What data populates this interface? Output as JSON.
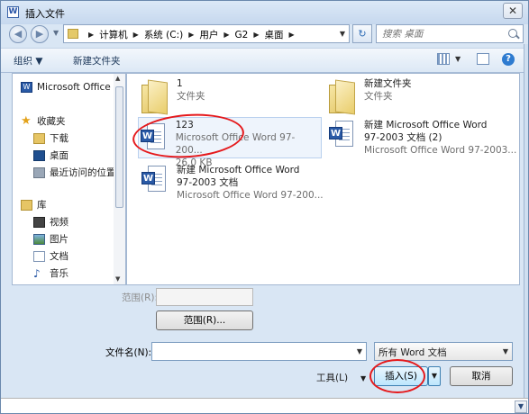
{
  "window": {
    "title": "插入文件",
    "title_icon": "W",
    "close_label": "✕"
  },
  "address": {
    "crumbs": [
      "计算机",
      "系统 (C:)",
      "用户",
      "G2",
      "桌面"
    ]
  },
  "search": {
    "placeholder": "搜索 桌面"
  },
  "toolbar": {
    "organize": "组织 ▼",
    "new_folder": "新建文件夹"
  },
  "nav": {
    "items": [
      {
        "label": "Microsoft Office W",
        "icon": "word-icon"
      },
      {
        "label": "收藏夹",
        "icon": "star-icon"
      },
      {
        "label": "下载",
        "icon": "download-folder-icon"
      },
      {
        "label": "桌面",
        "icon": "desktop-icon"
      },
      {
        "label": "最近访问的位置",
        "icon": "recent-places-icon"
      },
      {
        "label": "库",
        "icon": "library-icon"
      },
      {
        "label": "视频",
        "icon": "video-icon"
      },
      {
        "label": "图片",
        "icon": "picture-icon"
      },
      {
        "label": "文档",
        "icon": "document-icon"
      },
      {
        "label": "音乐",
        "icon": "music-icon"
      }
    ]
  },
  "files": [
    {
      "name": "1",
      "type": "文件夹",
      "size": "",
      "kind": "folder"
    },
    {
      "name": "新建文件夹",
      "type": "文件夹",
      "size": "",
      "kind": "folder"
    },
    {
      "name": "123",
      "type": "Microsoft Office Word 97-200...",
      "size": "26.0 KB",
      "kind": "doc"
    },
    {
      "name": "新建 Microsoft Office Word 97-2003 文档 (2)",
      "name_line1": "新建 Microsoft Office Word",
      "name_line2": "97-2003 文档 (2)",
      "type": "Microsoft Office Word 97-2003...",
      "kind": "doc"
    },
    {
      "name_line1": "新建 Microsoft Office Word",
      "name_line2": "97-2003 文档",
      "type": "Microsoft Office Word 97-200...",
      "kind": "doc"
    }
  ],
  "range": {
    "label": "范围(R):",
    "button": "范围(R)..."
  },
  "filename": {
    "label": "文件名(N):",
    "value": ""
  },
  "filetype": {
    "selected": "所有 Word 文档"
  },
  "actions": {
    "tools": "工具(L)",
    "insert": "插入(S)",
    "cancel": "取消"
  },
  "colors": {
    "annotation": "#e5191c",
    "accent": "#2a5aa6"
  }
}
